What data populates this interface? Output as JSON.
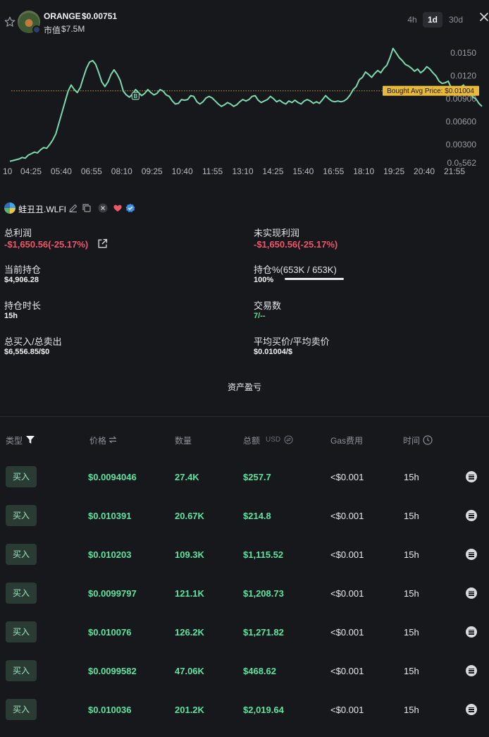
{
  "header": {
    "token_name": "ORANGE",
    "token_price": "$0.00751",
    "mcap_label": "市值",
    "mcap_value": "$7.5M",
    "timeframes": [
      "4h",
      "1d",
      "30d"
    ],
    "active_timeframe": "1d",
    "icons": {
      "favorite": "star-icon",
      "close": "close-icon"
    }
  },
  "chart_data": {
    "type": "line",
    "title": "",
    "xlabel": "",
    "ylabel": "",
    "x_tick_labels": [
      "10",
      "04:25",
      "05:40",
      "06:55",
      "08:10",
      "09:25",
      "10:40",
      "11:55",
      "13:10",
      "14:25",
      "15:40",
      "16:55",
      "18:10",
      "19:25",
      "20:40",
      "21:55"
    ],
    "y_tick_labels": [
      "0.0₅562",
      "0.00300",
      "0.00600",
      "0.00900",
      "0.0120",
      "0.0150"
    ],
    "y_ticks": [
      0.000562,
      0.003,
      0.006,
      0.009,
      0.012,
      0.015
    ],
    "ylim": [
      0.0004,
      0.0163
    ],
    "line_color": "#7fd9b0",
    "reference_line": {
      "value": 0.01004,
      "label": "Bought Avg Price: $0.01004",
      "color": "#e9b93a"
    },
    "trade_markers": [
      {
        "x_index": 41,
        "label": "B"
      }
    ],
    "series": [
      {
        "values": [
          0.0008,
          0.0009,
          0.001,
          0.0011,
          0.0013,
          0.0012,
          0.0016,
          0.0018,
          0.002,
          0.0019,
          0.0023,
          0.0026,
          0.0025,
          0.003,
          0.0036,
          0.0044,
          0.0058,
          0.0072,
          0.0086,
          0.01,
          0.0108,
          0.0102,
          0.0098,
          0.0105,
          0.0118,
          0.013,
          0.0138,
          0.014,
          0.0135,
          0.0124,
          0.0112,
          0.0106,
          0.0112,
          0.0122,
          0.0128,
          0.0122,
          0.0114,
          0.01,
          0.0095,
          0.0092,
          0.0096,
          0.0102,
          0.0098,
          0.0094,
          0.0097,
          0.0102,
          0.0098,
          0.0095,
          0.0097,
          0.0102,
          0.01,
          0.0095,
          0.0093,
          0.0087,
          0.0083,
          0.0084,
          0.0089,
          0.0088,
          0.0089,
          0.0094,
          0.0093,
          0.0086,
          0.0083,
          0.0086,
          0.0091,
          0.0093,
          0.0091,
          0.0087,
          0.0083,
          0.008,
          0.0082,
          0.0085,
          0.0083,
          0.008,
          0.0082,
          0.0086,
          0.0089,
          0.0087,
          0.0089,
          0.0093,
          0.0094,
          0.0088,
          0.0085,
          0.0087,
          0.0089,
          0.0093,
          0.009,
          0.0086,
          0.0088,
          0.0085,
          0.0083,
          0.0087,
          0.0085,
          0.0088,
          0.0085,
          0.0083,
          0.0087,
          0.0089,
          0.0087,
          0.0084,
          0.0086,
          0.0084,
          0.0089,
          0.0094,
          0.009,
          0.0087,
          0.0086,
          0.0087,
          0.0086,
          0.0087,
          0.009,
          0.0095,
          0.0102,
          0.0106,
          0.0115,
          0.0118,
          0.0125,
          0.0122,
          0.0118,
          0.0123,
          0.0127,
          0.0124,
          0.013,
          0.0134,
          0.0144,
          0.0156,
          0.015,
          0.0144,
          0.014,
          0.0135,
          0.0133,
          0.013,
          0.0126,
          0.0129,
          0.0124,
          0.0127,
          0.0132,
          0.0129,
          0.0124,
          0.012,
          0.0113,
          0.011,
          0.0111,
          0.0113,
          0.0104,
          0.0103,
          0.0101,
          0.0105,
          0.0108,
          0.01,
          0.0098,
          0.0092,
          0.009,
          0.0084,
          0.008
        ]
      }
    ]
  },
  "wallet": {
    "name": "蛙丑丑.WLFI",
    "icons": [
      "wallet-avatar",
      "edit-icon",
      "copy-icon",
      "x-icon",
      "heart-icon",
      "verified-icon"
    ]
  },
  "stats": {
    "total_profit": {
      "label": "总利润",
      "value": "-$1,650.56(-25.17%)"
    },
    "unrealized_profit": {
      "label": "未实现利润",
      "value": "-$1,650.56(-25.17%)"
    },
    "current_position": {
      "label": "当前持仓",
      "value": "$4,906.28"
    },
    "position_pct": {
      "label": "持仓%(653K / 653K)",
      "value": "100%",
      "fraction": 1.0
    },
    "holding_time": {
      "label": "持仓时长",
      "value": "15h"
    },
    "trade_count": {
      "label": "交易数",
      "value": "7/--"
    },
    "buy_sell_total": {
      "label": "总买入/总卖出",
      "value": "$6,556.85/$0"
    },
    "avg_price": {
      "label": "平均买价/平均卖价",
      "value": "$0.01004/$"
    },
    "pnl_button": "资产盈亏"
  },
  "table": {
    "headers": {
      "type": "类型",
      "price": "价格",
      "qty": "数量",
      "total": "总额",
      "total_unit": "USD",
      "gas": "Gas费用",
      "time": "时间"
    },
    "rows": [
      {
        "type": "买入",
        "price": "$0.0094046",
        "qty": "27.4K",
        "total": "$257.7",
        "gas": "<$0.001",
        "time": "15h"
      },
      {
        "type": "买入",
        "price": "$0.010391",
        "qty": "20.67K",
        "total": "$214.8",
        "gas": "<$0.001",
        "time": "15h"
      },
      {
        "type": "买入",
        "price": "$0.010203",
        "qty": "109.3K",
        "total": "$1,115.52",
        "gas": "<$0.001",
        "time": "15h"
      },
      {
        "type": "买入",
        "price": "$0.0099797",
        "qty": "121.1K",
        "total": "$1,208.73",
        "gas": "<$0.001",
        "time": "15h"
      },
      {
        "type": "买入",
        "price": "$0.010076",
        "qty": "126.2K",
        "total": "$1,271.82",
        "gas": "<$0.001",
        "time": "15h"
      },
      {
        "type": "买入",
        "price": "$0.0099582",
        "qty": "47.06K",
        "total": "$468.62",
        "gas": "<$0.001",
        "time": "15h"
      },
      {
        "type": "买入",
        "price": "$0.010036",
        "qty": "201.2K",
        "total": "$2,019.64",
        "gas": "<$0.001",
        "time": "15h"
      }
    ]
  }
}
